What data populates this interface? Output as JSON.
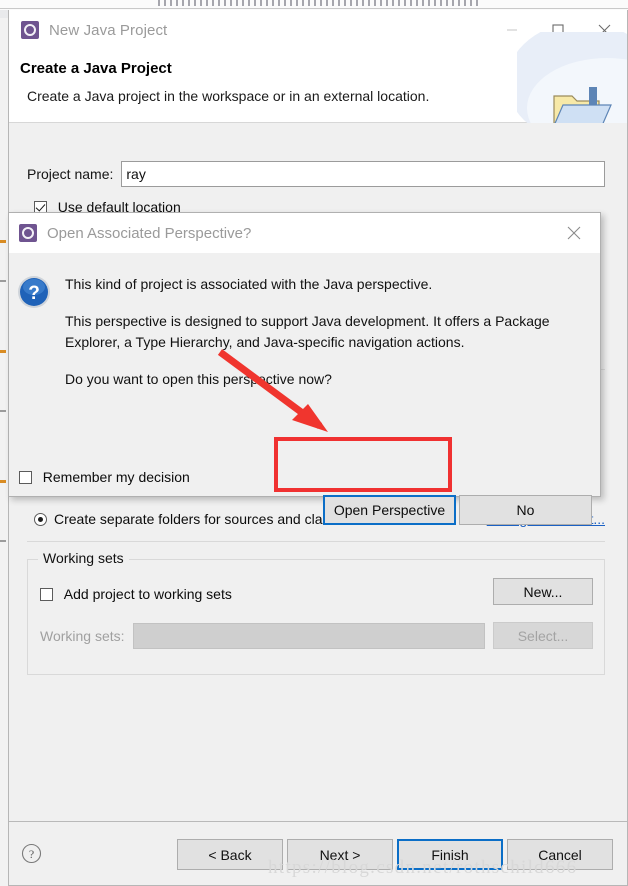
{
  "window": {
    "title": "New Java Project",
    "icon": "java-project-gear-icon",
    "controls": {
      "minimize": "minimize-icon",
      "maximize": "maximize-icon",
      "close": "close-icon"
    }
  },
  "banner": {
    "title": "Create a Java Project",
    "subtitle": "Create a Java project in the workspace or in an external location.",
    "icon": "java-project-folder-icon"
  },
  "form": {
    "project_name_label": "Project name:",
    "project_name_value": "ray",
    "project_name_placeholder": "",
    "use_default_location_label": "Use default location",
    "use_default_location_checked": true,
    "separate_folders_label": "Create separate folders for sources and class files",
    "separate_folders_selected": true,
    "configure_default_link": "Configure default...",
    "working_sets": {
      "legend": "Working sets",
      "add_checkbox_label": "Add project to working sets",
      "add_checkbox_checked": false,
      "new_button": "New...",
      "combo_label": "Working sets:",
      "combo_value": "",
      "select_button": "Select..."
    }
  },
  "footer": {
    "help_icon": "help-question-icon",
    "buttons": [
      {
        "label": "< Back",
        "primary": false
      },
      {
        "label": "Next >",
        "primary": false
      },
      {
        "label": "Finish",
        "primary": true
      },
      {
        "label": "Cancel",
        "primary": false
      }
    ]
  },
  "modal": {
    "title": "Open Associated Perspective?",
    "icon": "java-perspective-gear-icon",
    "close_icon": "close-icon",
    "question_icon": "question-mark-icon",
    "paragraphs": [
      "This kind of project is associated with the Java perspective.",
      "This perspective is designed to support Java development. It offers a Package Explorer, a Type Hierarchy, and Java-specific navigation actions.",
      "Do you want to open this perspective now?"
    ],
    "remember_label": "Remember my decision",
    "remember_checked": false,
    "buttons": [
      {
        "label": "Open Perspective",
        "focused": true
      },
      {
        "label": "No",
        "focused": false
      }
    ]
  },
  "annotations": {
    "highlight_color": "#f03131",
    "arrow_color": "#f0352e",
    "focus_color": "#0b6ec7"
  },
  "watermark": {
    "text": "https://blog.csdn.net/rothschild666"
  }
}
